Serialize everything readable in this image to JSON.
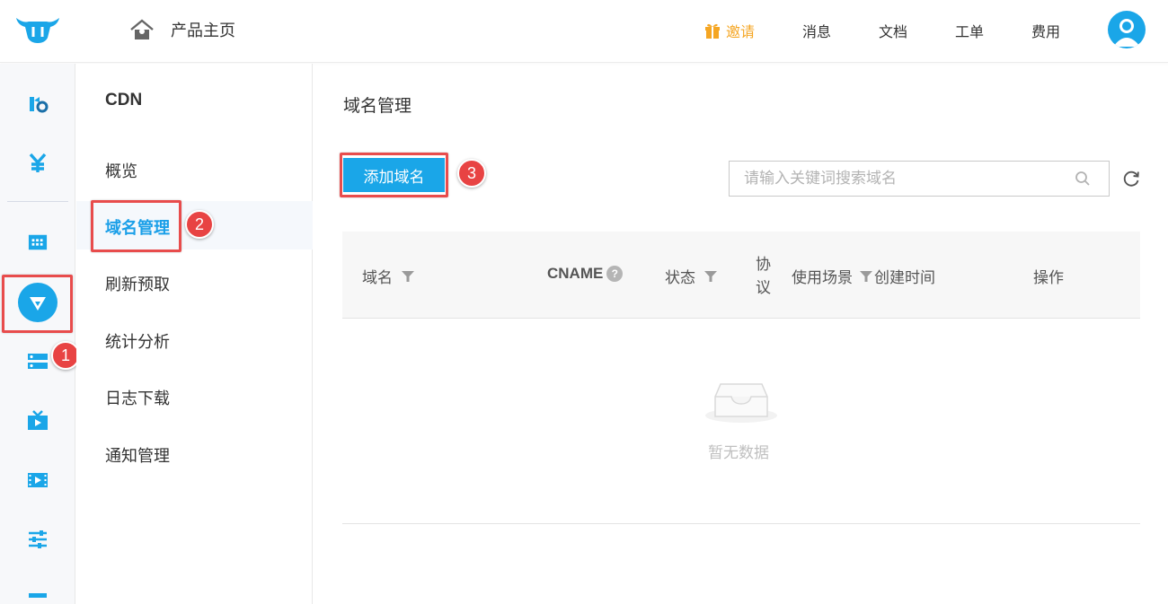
{
  "header": {
    "home_label": "产品主页",
    "nav": {
      "invite": "邀请",
      "messages": "消息",
      "docs": "文档",
      "tickets": "工单",
      "billing": "费用"
    }
  },
  "submenu": {
    "title": "CDN",
    "items": [
      "概览",
      "域名管理",
      "刷新预取",
      "统计分析",
      "日志下载",
      "通知管理"
    ],
    "active_index": 1
  },
  "main": {
    "title": "域名管理",
    "add_button": "添加域名",
    "search_placeholder": "请输入关键词搜索域名",
    "columns": {
      "domain": "域名",
      "cname": "CNAME",
      "cname_help": "?",
      "status": "状态",
      "protocol": "协议",
      "scene": "使用场景",
      "created": "创建时间",
      "actions": "操作"
    },
    "empty_text": "暂无数据"
  },
  "annotations": [
    "1",
    "2",
    "3"
  ],
  "colors": {
    "accent": "#1aa6e8",
    "invite": "#f5a623",
    "highlight": "#e84c4c"
  },
  "icons": {
    "logo": "bull-logo-icon",
    "home": "home-icon",
    "invite": "gift-icon",
    "avatar": "user-avatar-icon",
    "search": "search-icon",
    "refresh": "refresh-icon",
    "rail": [
      "ai-icon",
      "yuan-icon",
      "dashboard-icon",
      "cdn-icon",
      "storage-icon",
      "live-icon",
      "video-icon",
      "settings-icon",
      "more-icon"
    ]
  }
}
